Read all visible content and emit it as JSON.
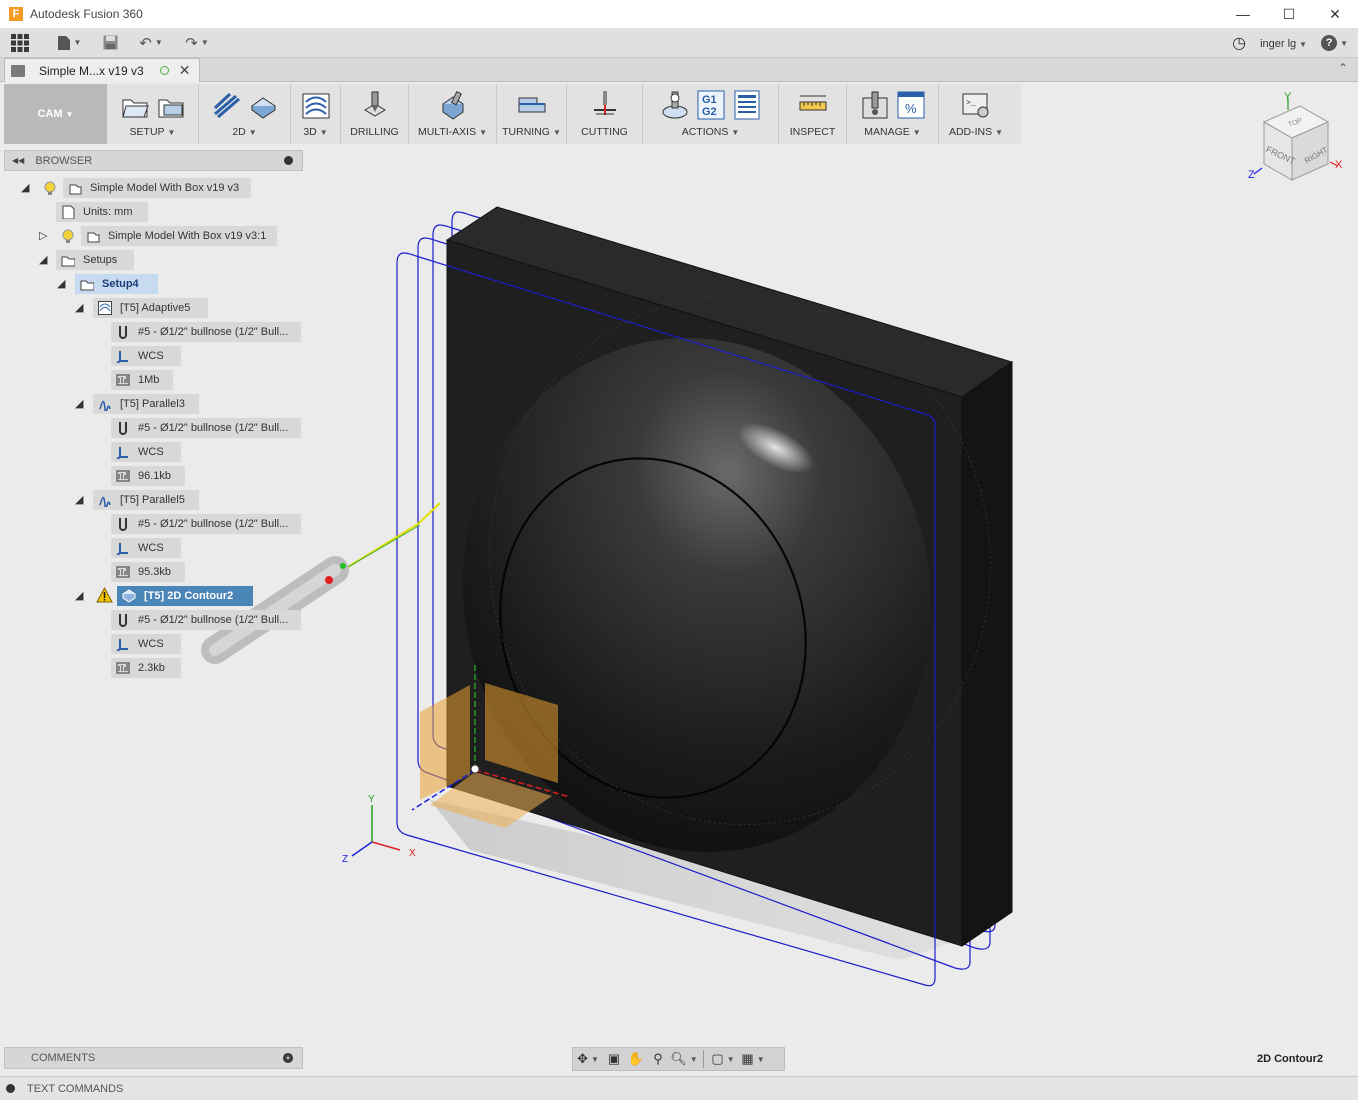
{
  "window": {
    "title": "Autodesk Fusion 360",
    "logo_letter": "F"
  },
  "qat": {
    "user": "inger lg"
  },
  "document_tab": {
    "name": "Simple M...x v19 v3"
  },
  "ribbon": {
    "workspace": "CAM",
    "groups": [
      {
        "label": "SETUP",
        "dropdown": true
      },
      {
        "label": "2D",
        "dropdown": true
      },
      {
        "label": "3D",
        "dropdown": true
      },
      {
        "label": "DRILLING",
        "dropdown": false
      },
      {
        "label": "MULTI-AXIS",
        "dropdown": true
      },
      {
        "label": "TURNING",
        "dropdown": true
      },
      {
        "label": "CUTTING",
        "dropdown": false
      },
      {
        "label": "ACTIONS",
        "dropdown": true
      },
      {
        "label": "INSPECT",
        "dropdown": false
      },
      {
        "label": "MANAGE",
        "dropdown": true
      },
      {
        "label": "ADD-INS",
        "dropdown": true
      }
    ],
    "gcode_icon": {
      "line1": "G1",
      "line2": "G2"
    }
  },
  "viewcube": {
    "top": "TOP",
    "front": "FRONT",
    "right": "RIGHT",
    "axis_x": "X",
    "axis_y": "Y",
    "axis_z": "Z"
  },
  "browser": {
    "title": "BROWSER",
    "nodes": [
      {
        "label": "Simple Model With Box v19 v3",
        "icon": "document-icon"
      },
      {
        "label": "Units: mm",
        "icon": "units-icon"
      },
      {
        "label": "Simple Model With Box v19 v3:1",
        "icon": "component-icon"
      },
      {
        "label": "Setups",
        "icon": "setups-folder-icon"
      },
      {
        "label": "Setup4",
        "icon": "setup-icon"
      },
      {
        "label": "[T5] Adaptive5",
        "icon": "adaptive-icon"
      },
      {
        "label": "#5 - Ø1/2\" bullnose (1/2\" Bull...",
        "icon": "tool-icon"
      },
      {
        "label": "WCS",
        "icon": "wcs-icon"
      },
      {
        "label": "1Mb",
        "icon": "toolpath-size-icon"
      },
      {
        "label": "[T5] Parallel3",
        "icon": "parallel-icon"
      },
      {
        "label": "#5 - Ø1/2\" bullnose (1/2\" Bull...",
        "icon": "tool-icon"
      },
      {
        "label": "WCS",
        "icon": "wcs-icon"
      },
      {
        "label": "96.1kb",
        "icon": "toolpath-size-icon"
      },
      {
        "label": "[T5] Parallel5",
        "icon": "parallel-icon"
      },
      {
        "label": "#5 - Ø1/2\" bullnose (1/2\" Bull...",
        "icon": "tool-icon"
      },
      {
        "label": "WCS",
        "icon": "wcs-icon"
      },
      {
        "label": "95.3kb",
        "icon": "toolpath-size-icon"
      },
      {
        "label": "[T5] 2D Contour2",
        "icon": "contour-icon"
      },
      {
        "label": "#5 - Ø1/2\" bullnose (1/2\" Bull...",
        "icon": "tool-icon"
      },
      {
        "label": "WCS",
        "icon": "wcs-icon"
      },
      {
        "label": "2.3kb",
        "icon": "toolpath-size-icon"
      }
    ]
  },
  "triad": {
    "x": "X",
    "y": "Y",
    "z": "Z"
  },
  "comments": {
    "label": "COMMENTS"
  },
  "status": {
    "operation": "2D Contour2"
  },
  "text_commands": {
    "label": "TEXT COMMANDS"
  },
  "colors": {
    "toolpath_blue": "#1c1ccc",
    "stock_dark": "#1d1d1d",
    "selected": "#4a85b8",
    "warning": "#f3c400"
  }
}
